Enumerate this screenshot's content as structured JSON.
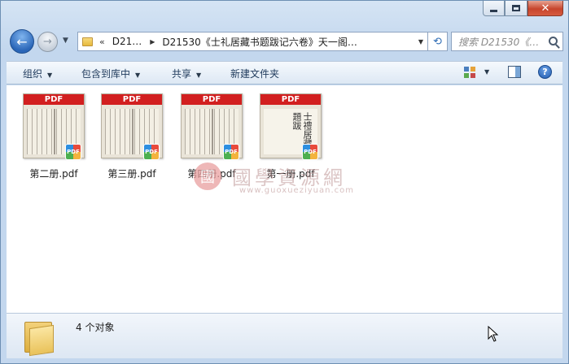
{
  "window": {
    "caption": {
      "minimize": "minimize",
      "maximize": "maximize",
      "close": "✕"
    }
  },
  "nav": {
    "back": "back",
    "forward": "forward",
    "address": {
      "chevron": "«",
      "segments": [
        "D21…",
        "D21530《士礼居藏书题跋记六卷》天一阁…"
      ],
      "separator": "▶"
    },
    "search_placeholder": "搜索 D21530《…"
  },
  "commandbar": {
    "organize": "组织",
    "include_in_library": "包含到库中",
    "share": "共享",
    "new_folder": "新建文件夹"
  },
  "files": [
    {
      "name": "第二册.pdf",
      "band": "PDF",
      "badge": "PDF",
      "thumb": "lined"
    },
    {
      "name": "第三册.pdf",
      "band": "PDF",
      "badge": "PDF",
      "thumb": "lined"
    },
    {
      "name": "第四册.pdf",
      "band": "PDF",
      "badge": "PDF",
      "thumb": "lined"
    },
    {
      "name": "第一册.pdf",
      "band": "PDF",
      "badge": "PDF",
      "thumb": "calligraphy"
    }
  ],
  "watermark": {
    "seal": "國",
    "title": "國學資源網",
    "url": "www.guoxueziyuan.com"
  },
  "details": {
    "count_text": "4 个对象"
  },
  "colors": {
    "pdf_red": "#d21f1f",
    "window_blue": "#c3d7ee",
    "link_blue": "#1e395b"
  },
  "icons": [
    "back-icon",
    "forward-icon",
    "folder-icon",
    "refresh-icon",
    "search-icon",
    "view-icon",
    "preview-pane-icon",
    "help-icon",
    "pdf-icon"
  ]
}
